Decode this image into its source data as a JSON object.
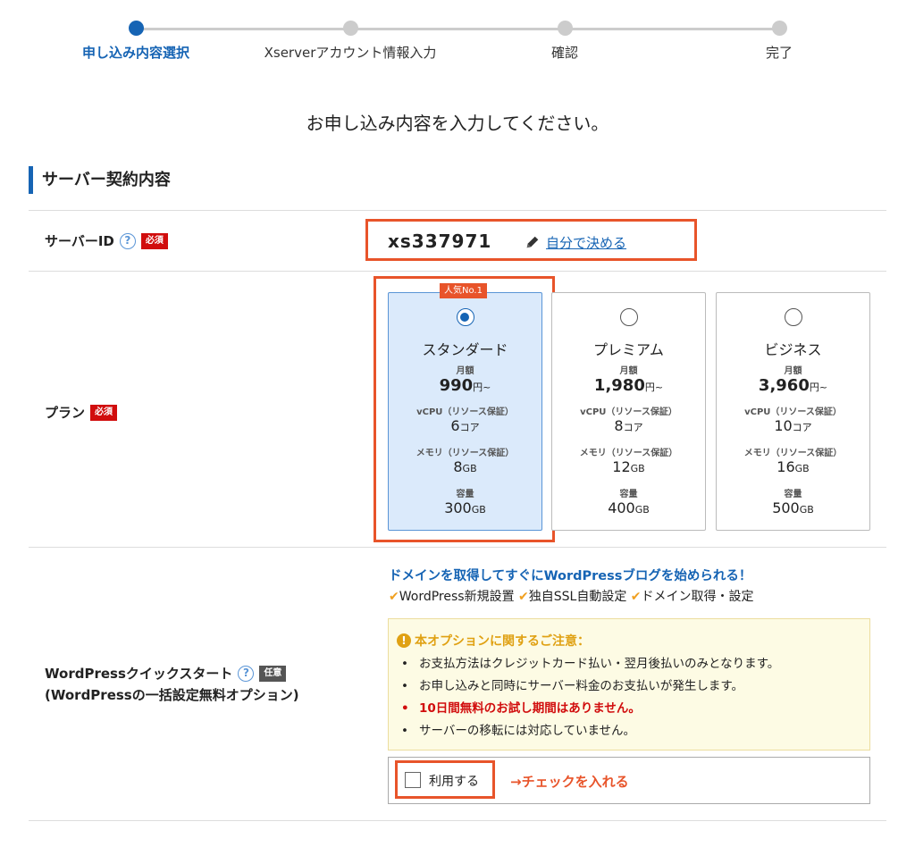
{
  "stepper": {
    "steps": [
      {
        "label": "申し込み内容選択",
        "active": true
      },
      {
        "label": "Xserverアカウント情報入力",
        "active": false
      },
      {
        "label": "確認",
        "active": false
      },
      {
        "label": "完了",
        "active": false
      }
    ]
  },
  "page": {
    "title": "お申し込み内容を入力してください。"
  },
  "section": {
    "title": "サーバー契約内容"
  },
  "server_id": {
    "label": "サーバーID",
    "help": "?",
    "badge": "必須",
    "value": "xs337971",
    "link": "自分で決める"
  },
  "plan": {
    "label": "プラン",
    "badge": "必須",
    "popular": "人気No.1",
    "month_label": "月額",
    "cpu_label": "vCPU（リソース保証）",
    "mem_label": "メモリ（リソース保証）",
    "cap_label": "容量",
    "price_unit": "円~",
    "core_unit": "コア",
    "gb_unit": "GB",
    "cards": [
      {
        "name": "スタンダード",
        "price": "990",
        "cpu": "6",
        "mem": "8",
        "cap": "300",
        "selected": true
      },
      {
        "name": "プレミアム",
        "price": "1,980",
        "cpu": "8",
        "mem": "12",
        "cap": "400",
        "selected": false
      },
      {
        "name": "ビジネス",
        "price": "3,960",
        "cpu": "10",
        "mem": "16",
        "cap": "500",
        "selected": false
      }
    ]
  },
  "wordpress": {
    "label": "WordPressクイックスタート",
    "sublabel": "(WordPressの一括設定無料オプション)",
    "help": "?",
    "badge": "任意",
    "headline": "ドメインを取得してすぐにWordPressブログを始められる！",
    "features": [
      "WordPress新規設置",
      "独自SSL自動設定",
      "ドメイン取得・設定"
    ],
    "notice_title": "本オプションに関するご注意：",
    "notices": [
      {
        "text": "お支払方法はクレジットカード払い・翌月後払いのみとなります。",
        "red": false
      },
      {
        "text": "お申し込みと同時にサーバー料金のお支払いが発生します。",
        "red": false
      },
      {
        "text": "10日間無料のお試し期間はありません。",
        "red": true
      },
      {
        "text": "サーバーの移転には対応していません。",
        "red": false
      }
    ],
    "use_label": "利用する",
    "annotation": "→チェックを入れる"
  },
  "colors": {
    "primary": "#1664b4",
    "highlight": "#e8542a",
    "required": "#d10d0d",
    "notice_bg": "#fdfbe4"
  }
}
